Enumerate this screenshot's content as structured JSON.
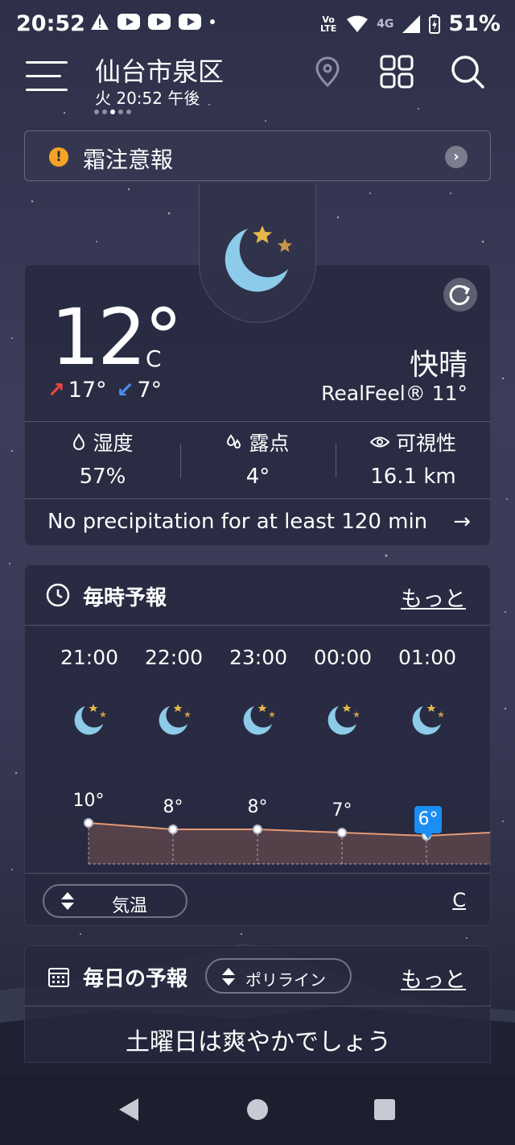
{
  "status_bar": {
    "time": "20:52",
    "network": "4G",
    "volte": "Vo LTE",
    "battery": "51%"
  },
  "header": {
    "city": "仙台市泉区",
    "datetime": "火 20:52 午後"
  },
  "alert": {
    "text": "霜注意報"
  },
  "current": {
    "temperature": "12°",
    "unit": "C",
    "high": "17°",
    "low": "7°",
    "condition": "快晴",
    "realfeel": "RealFeel® 11°",
    "humidity_label": "湿度",
    "humidity_value": "57%",
    "dewpoint_label": "露点",
    "dewpoint_value": "4°",
    "visibility_label": "可視性",
    "visibility_value": "16.1 km",
    "precip_text": "No precipitation for at least 120 min",
    "precip_arrow": "→"
  },
  "hourly": {
    "title": "毎時予報",
    "more": "もっと",
    "hours": [
      "21:00",
      "22:00",
      "23:00",
      "00:00",
      "01:00"
    ],
    "temps": [
      "10°",
      "8°",
      "8°",
      "7°",
      "6°"
    ],
    "metric": "気温",
    "unit": "C"
  },
  "chart_data": {
    "type": "line",
    "categories": [
      "21:00",
      "22:00",
      "23:00",
      "00:00",
      "01:00"
    ],
    "values": [
      10,
      8,
      8,
      7,
      6
    ],
    "title": "",
    "xlabel": "",
    "ylabel": ""
  },
  "daily": {
    "title": "毎日の予報",
    "mode": "ポリライン",
    "more": "もっと",
    "summary": "土曜日は爽やかでしょう"
  },
  "colors": {
    "accent": "#1a8ef2",
    "alert": "#f7a325",
    "high_arrow": "#f0483e",
    "low_arrow": "#4d8ff0",
    "moon": "#8ccbe9",
    "star": "#e6b84a"
  }
}
